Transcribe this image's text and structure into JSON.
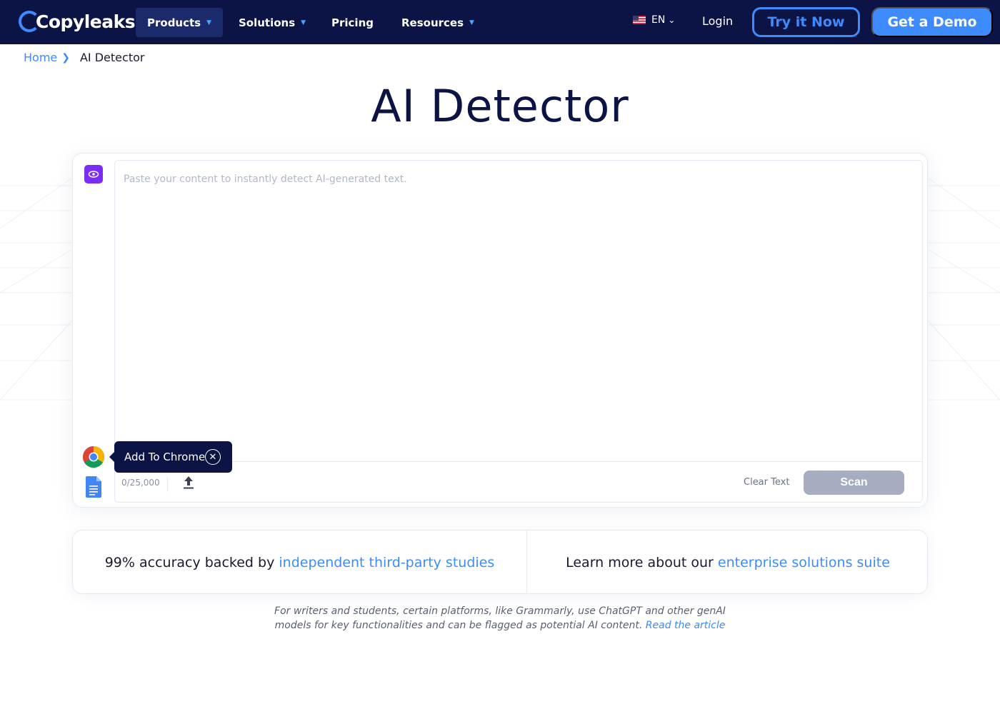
{
  "nav": {
    "logo_text": "Copyleaks",
    "items": [
      {
        "label": "Products",
        "has_caret": true,
        "active": true
      },
      {
        "label": "Solutions",
        "has_caret": true,
        "active": false
      },
      {
        "label": "Pricing",
        "has_caret": false,
        "active": false
      },
      {
        "label": "Resources",
        "has_caret": true,
        "active": false
      }
    ],
    "language": "EN",
    "login": "Login",
    "try_button": "Try it Now",
    "demo_button": "Get a Demo"
  },
  "breadcrumb": {
    "home": "Home",
    "current": "AI Detector"
  },
  "page_title": "AI Detector",
  "editor": {
    "placeholder": "Paste your content to instantly detect AI-generated text.",
    "value": "",
    "counter": "0/25,000",
    "clear_label": "Clear Text",
    "scan_label": "Scan"
  },
  "tooltip": {
    "label": "Add To Chrome"
  },
  "info": {
    "left_text": "99% accuracy backed by ",
    "left_link": "independent third-party studies",
    "right_text": "Learn more about our ",
    "right_link": "enterprise solutions suite"
  },
  "note": {
    "line1": "For writers and students, certain platforms, like Grammarly, use ChatGPT and other genAI",
    "line2": "models for key functionalities and can be flagged as potential AI content. ",
    "link": "Read the article"
  },
  "colors": {
    "nav_bg": "#0c1445",
    "accent": "#3d8bff",
    "scan_disabled": "#a7adc0",
    "eye_purple": "#7b2cf5"
  }
}
